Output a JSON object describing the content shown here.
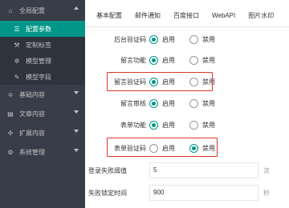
{
  "sidebar": {
    "items": [
      {
        "label": "全局配置",
        "icon": "home-icon",
        "expanded": true
      },
      {
        "label": "配置参数",
        "icon": "config-icon",
        "active": true
      },
      {
        "label": "定制标签",
        "icon": "wrench-icon"
      },
      {
        "label": "模型管理",
        "icon": "gear-icon"
      },
      {
        "label": "模型字段",
        "icon": "edit-icon"
      },
      {
        "label": "基础内容",
        "icon": "sliders-icon"
      },
      {
        "label": "文章内容",
        "icon": "document-icon"
      },
      {
        "label": "扩展内容",
        "icon": "grid-icon"
      },
      {
        "label": "系统管理",
        "icon": "settings-icon"
      }
    ]
  },
  "tabs": [
    "基本配置",
    "邮件通知",
    "百度接口",
    "WebAPI",
    "图片水印"
  ],
  "form": {
    "rows": [
      {
        "label": "后台验证码",
        "on": "启用",
        "off": "禁用",
        "selected": "on"
      },
      {
        "label": "留言功能",
        "on": "启用",
        "off": "禁用",
        "selected": "on"
      },
      {
        "label": "留言验证码",
        "on": "启用",
        "off": "禁用",
        "selected": "on"
      },
      {
        "label": "留言审核",
        "on": "启用",
        "off": "禁用",
        "selected": "on"
      },
      {
        "label": "表单功能",
        "on": "启用",
        "off": "禁用",
        "selected": "on"
      },
      {
        "label": "表单验证码",
        "on": "启用",
        "off": "禁用",
        "selected": "off"
      }
    ],
    "inputs": [
      {
        "label": "登录失败阈值",
        "value": "5",
        "unit": "次"
      },
      {
        "label": "失败锁定时间",
        "value": "900",
        "unit": "秒"
      }
    ]
  },
  "colors": {
    "accent": "#009688",
    "sidebar_bg": "#393d49",
    "highlight": "#e0352b"
  }
}
